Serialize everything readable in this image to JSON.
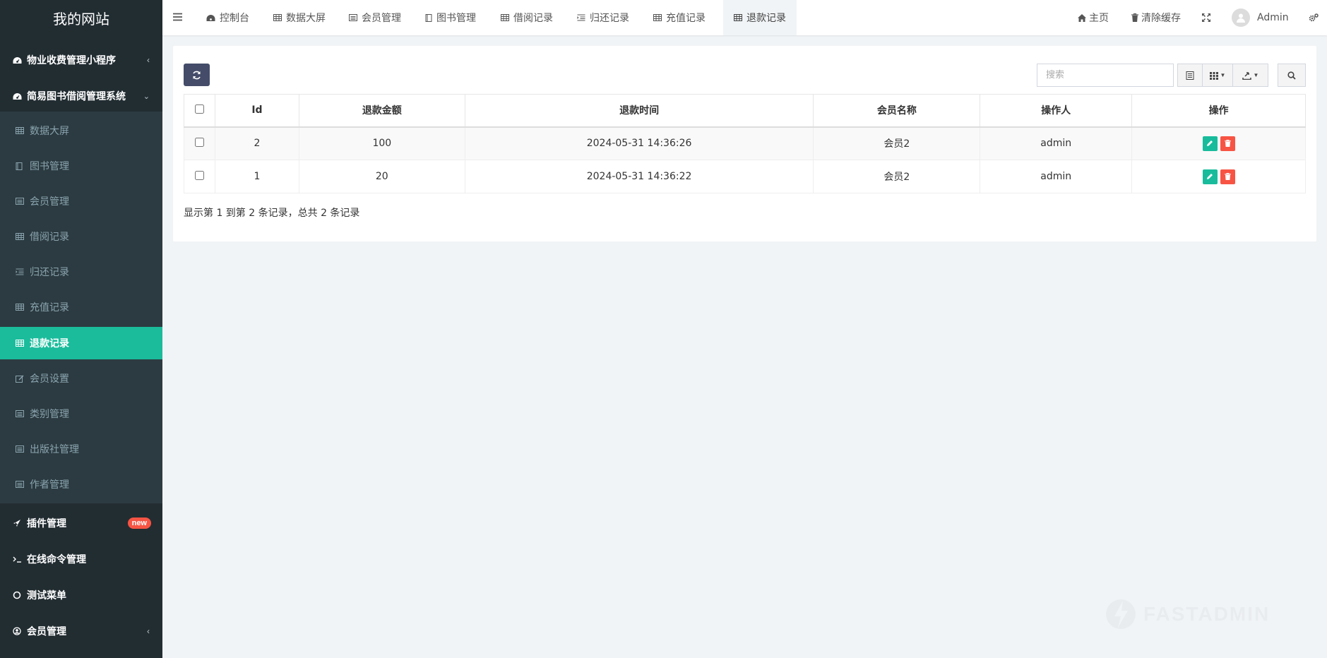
{
  "brand": "我的网站",
  "sidebar": {
    "groups": [
      {
        "label": "物业收费管理小程序",
        "icon": "dashboard-icon"
      },
      {
        "label": "简易图书借阅管理系统",
        "icon": "dashboard-icon"
      }
    ],
    "sub_items": [
      {
        "label": "数据大屏",
        "icon": "table-icon"
      },
      {
        "label": "图书管理",
        "icon": "book-icon"
      },
      {
        "label": "会员管理",
        "icon": "list-alt-icon"
      },
      {
        "label": "借阅记录",
        "icon": "table-icon"
      },
      {
        "label": "归还记录",
        "icon": "indent-icon"
      },
      {
        "label": "充值记录",
        "icon": "table-icon"
      },
      {
        "label": "退款记录",
        "icon": "table-icon"
      },
      {
        "label": "会员设置",
        "icon": "edit-icon"
      },
      {
        "label": "类别管理",
        "icon": "list-alt-icon"
      },
      {
        "label": "出版社管理",
        "icon": "list-alt-icon"
      },
      {
        "label": "作者管理",
        "icon": "list-alt-icon"
      }
    ],
    "bottom": [
      {
        "label": "插件管理",
        "icon": "rocket-icon",
        "badge": "new"
      },
      {
        "label": "在线命令管理",
        "icon": "terminal-icon"
      },
      {
        "label": "测试菜单",
        "icon": "circle-icon"
      },
      {
        "label": "会员管理",
        "icon": "user-circle-icon"
      }
    ]
  },
  "header": {
    "tabs": [
      {
        "label": "控制台",
        "icon": "dashboard-icon"
      },
      {
        "label": "数据大屏",
        "icon": "table-icon"
      },
      {
        "label": "会员管理",
        "icon": "list-alt-icon"
      },
      {
        "label": "图书管理",
        "icon": "book-icon"
      },
      {
        "label": "借阅记录",
        "icon": "table-icon"
      },
      {
        "label": "归还记录",
        "icon": "indent-icon"
      },
      {
        "label": "充值记录",
        "icon": "table-icon"
      },
      {
        "label": "退款记录",
        "icon": "table-icon"
      }
    ],
    "home_label": "主页",
    "clear_cache_label": "清除缓存",
    "user_name": "Admin"
  },
  "toolbar": {
    "search_placeholder": "搜索"
  },
  "table": {
    "columns": [
      "Id",
      "退款金额",
      "退款时间",
      "会员名称",
      "操作人",
      "操作"
    ],
    "rows": [
      {
        "id": "2",
        "amount": "100",
        "time": "2024-05-31 14:36:26",
        "member": "会员2",
        "operator": "admin"
      },
      {
        "id": "1",
        "amount": "20",
        "time": "2024-05-31 14:36:22",
        "member": "会员2",
        "operator": "admin"
      }
    ]
  },
  "pagination": "显示第 1 到第 2 条记录，总共 2 条记录",
  "watermark": "FASTADMIN",
  "colors": {
    "sidebar_bg": "#222d32",
    "submenu_bg": "#2c3b41",
    "active": "#1abc9c",
    "edit": "#18bc9c",
    "delete": "#f75444",
    "refresh_btn": "#444c69"
  }
}
